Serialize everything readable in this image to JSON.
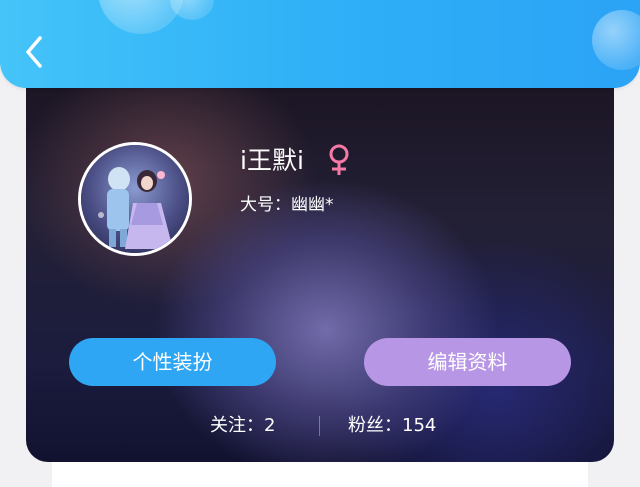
{
  "header": {
    "back_icon": "chevron-left-icon",
    "color": "#2fb0f7"
  },
  "profile": {
    "username": "i王默i",
    "gender_icon": "female-icon",
    "gender_color": "#f57aa6",
    "alias_label": "大号：",
    "alias_value": "幽幽*"
  },
  "actions": {
    "decorate_label": "个性装扮",
    "decorate_color": "#2ea6f4",
    "edit_label": "编辑资料",
    "edit_color": "#b896e6"
  },
  "stats": {
    "following_label": "关注：",
    "following_value": "2",
    "fans_label": "粉丝：",
    "fans_value": "154"
  }
}
